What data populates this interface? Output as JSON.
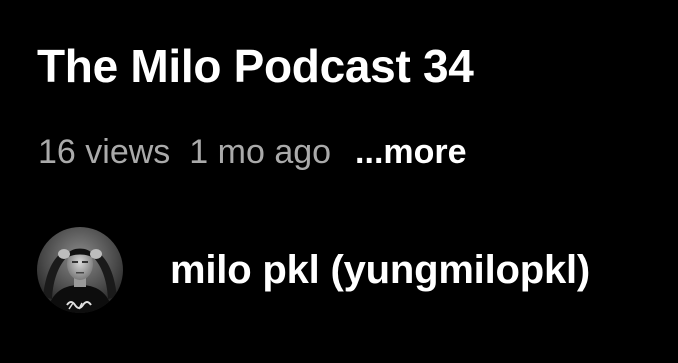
{
  "video": {
    "title": "The Milo Podcast 34",
    "views": "16 views",
    "age": "1 mo ago",
    "more_label": "...more"
  },
  "channel": {
    "name": "milo pkl (yungmilopkl)",
    "avatar_icon": "channel-avatar-photo"
  },
  "colors": {
    "background": "#000000",
    "primary_text": "#ffffff",
    "secondary_text": "#aaaaaa"
  }
}
